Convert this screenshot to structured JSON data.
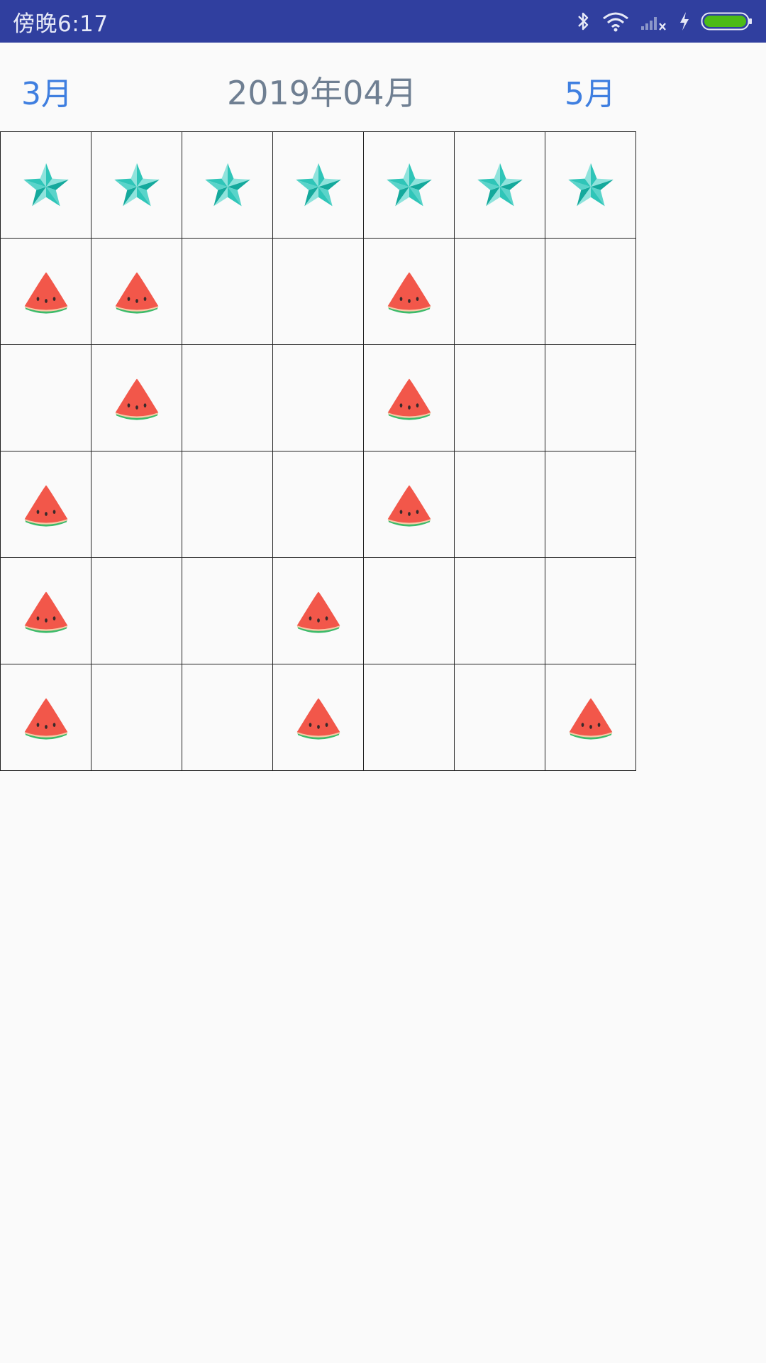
{
  "status_bar": {
    "time": "傍晚6:17",
    "icons": [
      "bluetooth-icon",
      "wifi-icon",
      "signal-no-service-icon",
      "charging-bolt-icon",
      "battery-full-icon"
    ],
    "battery_color": "#4cbb17"
  },
  "header": {
    "prev_month": "3月",
    "current_month": "2019年04月",
    "next_month": "5月",
    "accent_color": "#3f7fe0",
    "title_color": "#6f7f92"
  },
  "grid": {
    "columns": 7,
    "rows": 6,
    "cells": [
      [
        "star",
        "star",
        "star",
        "star",
        "star",
        "star",
        "star"
      ],
      [
        "watermelon",
        "watermelon",
        "",
        "",
        "watermelon",
        "",
        ""
      ],
      [
        "",
        "watermelon",
        "",
        "",
        "watermelon",
        "",
        ""
      ],
      [
        "watermelon",
        "",
        "",
        "",
        "watermelon",
        "",
        ""
      ],
      [
        "watermelon",
        "",
        "",
        "watermelon",
        "",
        "",
        ""
      ],
      [
        "watermelon",
        "",
        "",
        "watermelon",
        "",
        "",
        "watermelon"
      ]
    ],
    "star_color": "#2ec4b6",
    "watermelon_color": "#f2574a"
  }
}
